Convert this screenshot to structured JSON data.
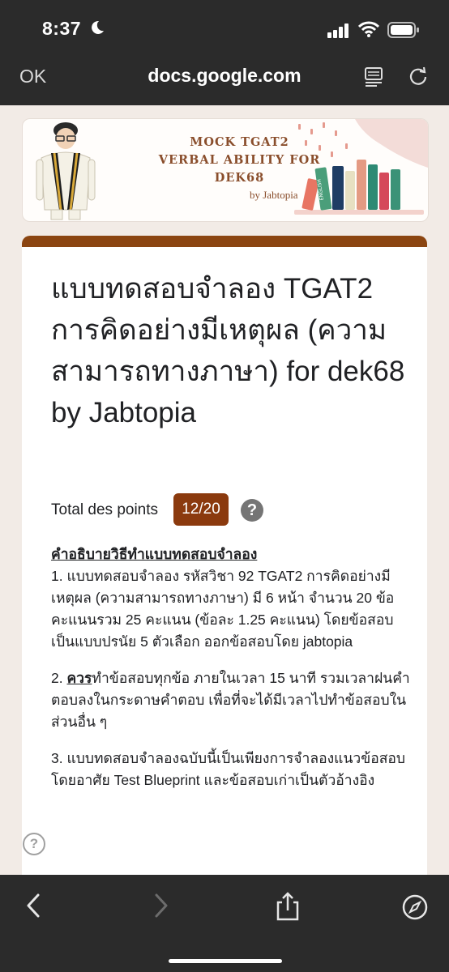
{
  "status_bar": {
    "time": "8:37"
  },
  "browser": {
    "ok_label": "OK",
    "url": "docs.google.com"
  },
  "banner": {
    "title_line1": "MOCK TGAT2",
    "title_line2": "VERBAL ABILITY FOR DEK68",
    "byline": "by Jabtopia",
    "book_label": "ENGLISH"
  },
  "form": {
    "title": "แบบทดสอบจำลอง TGAT2 การคิดอย่างมีเหตุผล (ความสามารถทางภาษา) for dek68 by Jabtopia",
    "points_label": "Total des points",
    "points_value": "12/20",
    "help_glyph": "?",
    "description": {
      "heading": "คำอธิบายวิธีทำแบบทดสอบจำลอง",
      "item1": "1. แบบทดสอบจำลอง รหัสวิชา 92 TGAT2 การคิดอย่างมีเหตุผล (ความสามารถทางภาษา) มี 6 หน้า จำนวน 20 ข้อ คะแนนรวม 25 คะแนน (ข้อละ 1.25 คะแนน) โดยข้อสอบเป็นแบบปรนัย 5 ตัวเลือก ออกข้อสอบโดย jabtopia",
      "item2_prefix": "2. ",
      "item2_emphasis": "ควร",
      "item2_rest": "ทำข้อสอบทุกข้อ ภายในเวลา 15 นาที รวมเวลาฝนคำตอบลงในกระดาษคำตอบ เพื่อที่จะได้มีเวลาไปทำข้อสอบในส่วนอื่น ๆ",
      "item3": "3. แบบทดสอบจำลองฉบับนี้เป็นเพียงการจำลองแนวข้อสอบ โดยอาศัย Test Blueprint และข้อสอบเก่าเป็นตัวอ้างอิง"
    }
  },
  "colors": {
    "accent": "#8b4511",
    "badge": "#8b3a0e",
    "bars": "#2b2b2b"
  }
}
